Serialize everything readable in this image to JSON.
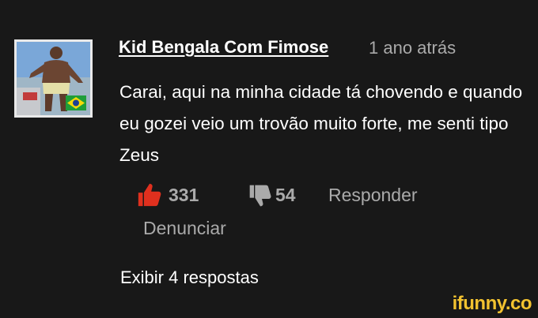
{
  "comment": {
    "author": "Kid Bengala Com Fimose",
    "timestamp": "1 ano atrás",
    "text": "Carai, aqui na minha cidade tá chovendo e quando eu gozei veio um trovão muito forte, me senti tipo Zeus",
    "likes": "331",
    "dislikes": "54",
    "reply_label": "Responder",
    "report_label": "Denunciar",
    "view_replies_label": "Exibir 4 respostas"
  },
  "icons": {
    "like": "thumbs-up-icon",
    "dislike": "thumbs-down-icon"
  },
  "colors": {
    "background": "#181818",
    "text": "#ffffff",
    "secondary_text": "#aaaaaa",
    "like_active": "#e0301e",
    "watermark": "#f2c230"
  },
  "watermark": "ifunny.co"
}
